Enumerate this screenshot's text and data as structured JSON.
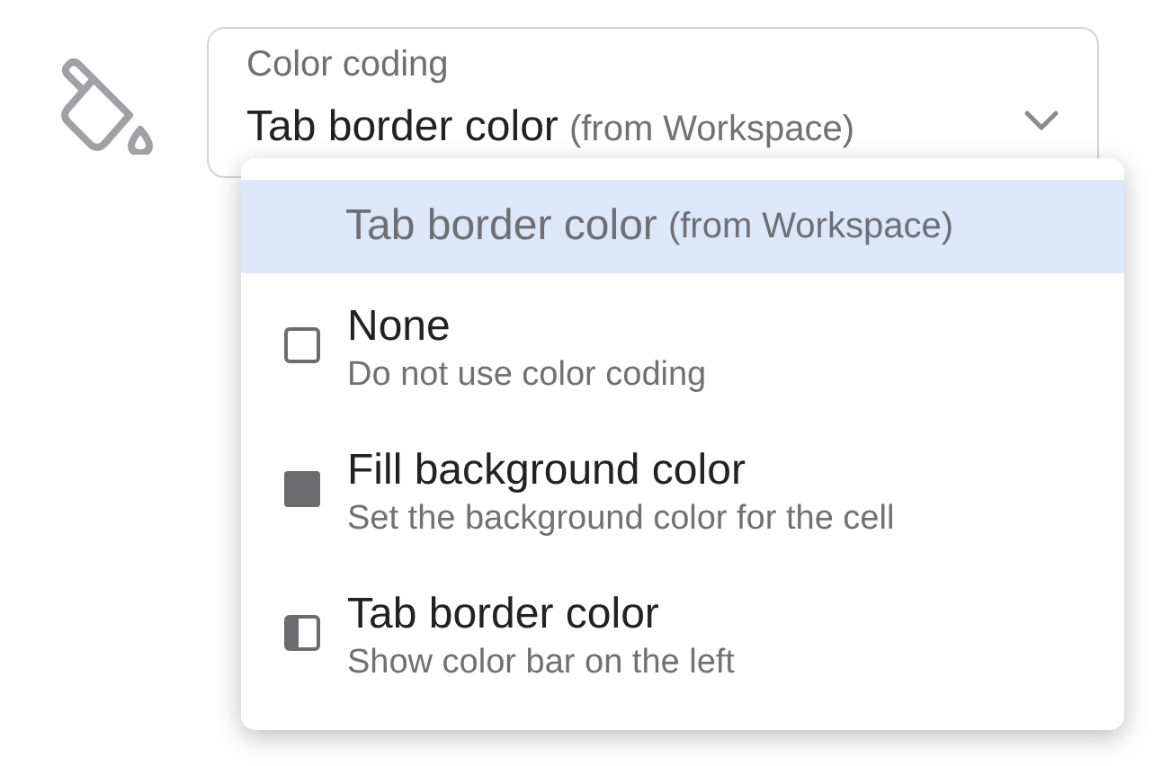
{
  "select": {
    "label": "Color coding",
    "value": "Tab border color",
    "value_note": "(from Workspace)",
    "expanded": true
  },
  "options": [
    {
      "kind": "inherit",
      "title": "Tab border color",
      "note": "(from Workspace)",
      "selected": true
    },
    {
      "kind": "none",
      "title": "None",
      "description": "Do not use color coding",
      "selected": false
    },
    {
      "kind": "fill",
      "title": "Fill background color",
      "description": "Set the background color for the cell",
      "selected": false
    },
    {
      "kind": "border",
      "title": "Tab border color",
      "description": "Show color bar on the left",
      "selected": false
    }
  ]
}
